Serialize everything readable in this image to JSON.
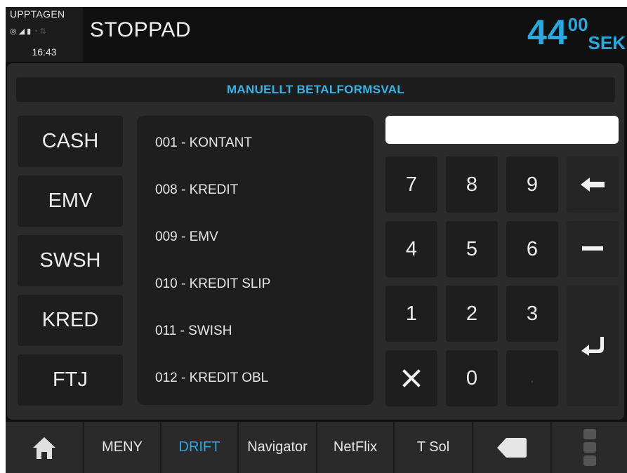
{
  "status": {
    "label": "UPPTAGEN",
    "icons": [
      "target-icon",
      "signal-icon",
      "battery-icon",
      "wifi-icon",
      "net-icon"
    ],
    "time": "16:43"
  },
  "header": {
    "state": "STOPPAD",
    "price_int": "44",
    "price_dec": "00",
    "currency": "SEK"
  },
  "panel": {
    "title": "MANUELLT BETALFORMSVAL"
  },
  "pay_buttons": [
    "CASH",
    "EMV",
    "SWSH",
    "KRED",
    "FTJ"
  ],
  "pay_list": [
    "001 - KONTANT",
    "008 - KREDIT",
    "009 - EMV",
    "010 - KREDIT SLIP",
    "011 - SWISH",
    "012 - KREDIT OBL"
  ],
  "input": {
    "value": "",
    "placeholder": ""
  },
  "keypad": {
    "k7": "7",
    "k8": "8",
    "k9": "9",
    "k4": "4",
    "k5": "5",
    "k6": "6",
    "k1": "1",
    "k2": "2",
    "k3": "3",
    "k0": "0",
    "comma": ","
  },
  "nav": {
    "menu": "MENY",
    "drift": "DRIFT",
    "navigator": "Navigator",
    "netflix": "NetFlix",
    "tsol": "T Sol"
  },
  "colors": {
    "accent": "#2aa8e0",
    "background": "#101010",
    "panel": "#2b2b2b",
    "button": "#1e1e1e"
  }
}
